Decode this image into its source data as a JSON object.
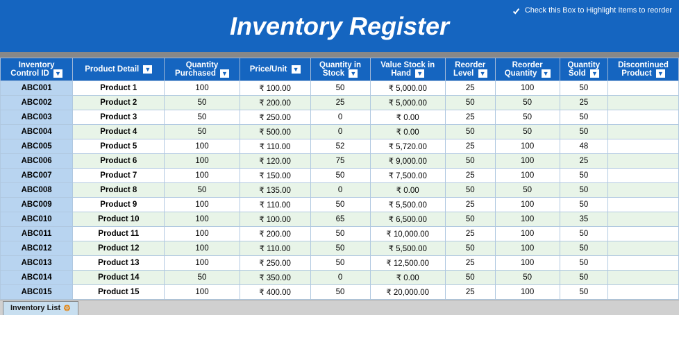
{
  "header": {
    "title": "Inventory Register",
    "checkbox_label": "Check this Box to Highlight Items to reorder"
  },
  "columns": [
    {
      "id": "control_id",
      "label": "Inventory Control ID"
    },
    {
      "id": "product_detail",
      "label": "Product Detail"
    },
    {
      "id": "qty_purchased",
      "label": "Quantity Purchased"
    },
    {
      "id": "price_unit",
      "label": "Price/Unit"
    },
    {
      "id": "qty_stock",
      "label": "Quantity in Stock"
    },
    {
      "id": "value_stock",
      "label": "Value Stock in Hand"
    },
    {
      "id": "reorder_level",
      "label": "Reorder Level"
    },
    {
      "id": "reorder_qty",
      "label": "Reorder Quantity"
    },
    {
      "id": "qty_sold",
      "label": "Quantity Sold"
    },
    {
      "id": "discontinued",
      "label": "Discontinued Product"
    }
  ],
  "rows": [
    {
      "id": "ABC001",
      "product": "Product 1",
      "qty_purchased": 100,
      "price": "₹ 100.00",
      "qty_stock": 50,
      "value_stock": "₹ 5,000.00",
      "reorder_level": 25,
      "reorder_qty": 100,
      "qty_sold": 50,
      "discontinued": ""
    },
    {
      "id": "ABC002",
      "product": "Product 2",
      "qty_purchased": 50,
      "price": "₹ 200.00",
      "qty_stock": 25,
      "value_stock": "₹ 5,000.00",
      "reorder_level": 50,
      "reorder_qty": 50,
      "qty_sold": 25,
      "discontinued": ""
    },
    {
      "id": "ABC003",
      "product": "Product 3",
      "qty_purchased": 50,
      "price": "₹ 250.00",
      "qty_stock": 0,
      "value_stock": "₹ 0.00",
      "reorder_level": 25,
      "reorder_qty": 50,
      "qty_sold": 50,
      "discontinued": ""
    },
    {
      "id": "ABC004",
      "product": "Product 4",
      "qty_purchased": 50,
      "price": "₹ 500.00",
      "qty_stock": 0,
      "value_stock": "₹ 0.00",
      "reorder_level": 50,
      "reorder_qty": 50,
      "qty_sold": 50,
      "discontinued": ""
    },
    {
      "id": "ABC005",
      "product": "Product 5",
      "qty_purchased": 100,
      "price": "₹ 110.00",
      "qty_stock": 52,
      "value_stock": "₹ 5,720.00",
      "reorder_level": 25,
      "reorder_qty": 100,
      "qty_sold": 48,
      "discontinued": ""
    },
    {
      "id": "ABC006",
      "product": "Product 6",
      "qty_purchased": 100,
      "price": "₹ 120.00",
      "qty_stock": 75,
      "value_stock": "₹ 9,000.00",
      "reorder_level": 50,
      "reorder_qty": 100,
      "qty_sold": 25,
      "discontinued": ""
    },
    {
      "id": "ABC007",
      "product": "Product 7",
      "qty_purchased": 100,
      "price": "₹ 150.00",
      "qty_stock": 50,
      "value_stock": "₹ 7,500.00",
      "reorder_level": 25,
      "reorder_qty": 100,
      "qty_sold": 50,
      "discontinued": ""
    },
    {
      "id": "ABC008",
      "product": "Product 8",
      "qty_purchased": 50,
      "price": "₹ 135.00",
      "qty_stock": 0,
      "value_stock": "₹ 0.00",
      "reorder_level": 50,
      "reorder_qty": 50,
      "qty_sold": 50,
      "discontinued": ""
    },
    {
      "id": "ABC009",
      "product": "Product 9",
      "qty_purchased": 100,
      "price": "₹ 110.00",
      "qty_stock": 50,
      "value_stock": "₹ 5,500.00",
      "reorder_level": 25,
      "reorder_qty": 100,
      "qty_sold": 50,
      "discontinued": ""
    },
    {
      "id": "ABC010",
      "product": "Product 10",
      "qty_purchased": 100,
      "price": "₹ 100.00",
      "qty_stock": 65,
      "value_stock": "₹ 6,500.00",
      "reorder_level": 50,
      "reorder_qty": 100,
      "qty_sold": 35,
      "discontinued": ""
    },
    {
      "id": "ABC011",
      "product": "Product 11",
      "qty_purchased": 100,
      "price": "₹ 200.00",
      "qty_stock": 50,
      "value_stock": "₹ 10,000.00",
      "reorder_level": 25,
      "reorder_qty": 100,
      "qty_sold": 50,
      "discontinued": ""
    },
    {
      "id": "ABC012",
      "product": "Product 12",
      "qty_purchased": 100,
      "price": "₹ 110.00",
      "qty_stock": 50,
      "value_stock": "₹ 5,500.00",
      "reorder_level": 50,
      "reorder_qty": 100,
      "qty_sold": 50,
      "discontinued": ""
    },
    {
      "id": "ABC013",
      "product": "Product 13",
      "qty_purchased": 100,
      "price": "₹ 250.00",
      "qty_stock": 50,
      "value_stock": "₹ 12,500.00",
      "reorder_level": 25,
      "reorder_qty": 100,
      "qty_sold": 50,
      "discontinued": ""
    },
    {
      "id": "ABC014",
      "product": "Product 14",
      "qty_purchased": 50,
      "price": "₹ 350.00",
      "qty_stock": 0,
      "value_stock": "₹ 0.00",
      "reorder_level": 50,
      "reorder_qty": 50,
      "qty_sold": 50,
      "discontinued": ""
    },
    {
      "id": "ABC015",
      "product": "Product 15",
      "qty_purchased": 100,
      "price": "₹ 400.00",
      "qty_stock": 50,
      "value_stock": "₹ 20,000.00",
      "reorder_level": 25,
      "reorder_qty": 100,
      "qty_sold": 50,
      "discontinued": ""
    }
  ],
  "tab": {
    "label": "Inventory List"
  }
}
